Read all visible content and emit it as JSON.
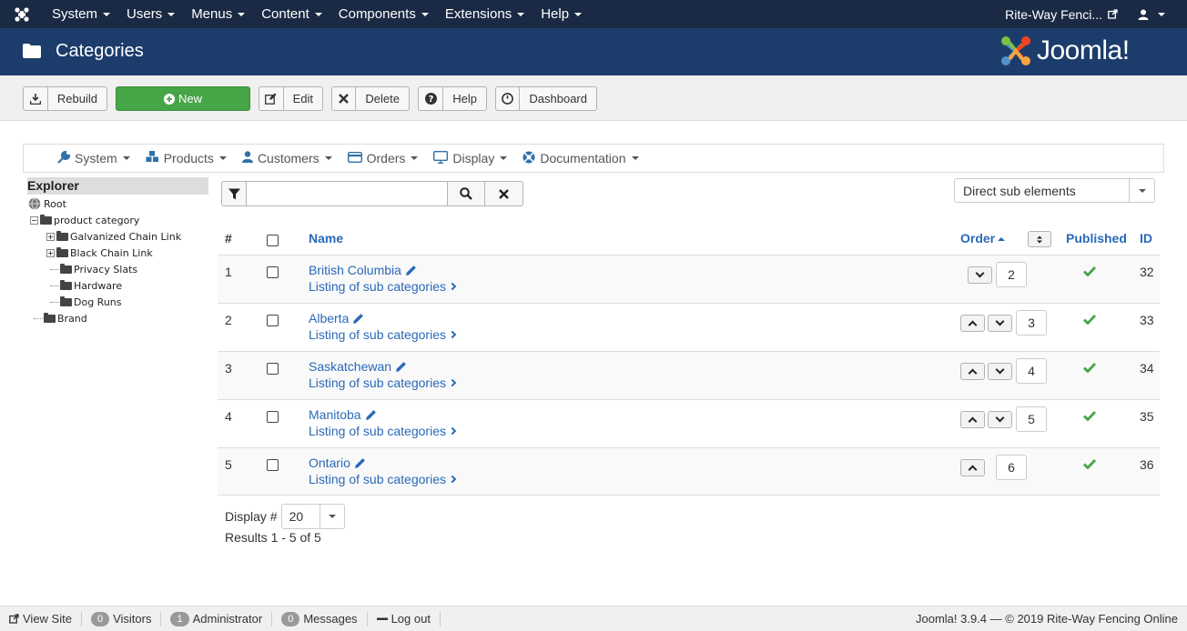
{
  "topnav": {
    "menus": [
      "System",
      "Users",
      "Menus",
      "Content",
      "Components",
      "Extensions",
      "Help"
    ],
    "site_name": "Rite-Way Fenci...",
    "icons": {
      "logo": "joomla-icon",
      "external": "external-link-icon",
      "user": "user-icon"
    }
  },
  "header": {
    "title": "Categories",
    "brand": "Joomla!"
  },
  "toolbar": {
    "rebuild": "Rebuild",
    "new": "New",
    "edit": "Edit",
    "delete": "Delete",
    "help": "Help",
    "dashboard": "Dashboard"
  },
  "subnav": {
    "items": [
      "System",
      "Products",
      "Customers",
      "Orders",
      "Display",
      "Documentation"
    ]
  },
  "explorer": {
    "title": "Explorer",
    "root": "Root",
    "product_category": "product category",
    "children": [
      "Galvanized Chain Link",
      "Black Chain Link",
      "Privacy Slats",
      "Hardware",
      "Dog Runs"
    ],
    "brand": "Brand"
  },
  "filters": {
    "search_placeholder": "",
    "direction": "Direct sub elements"
  },
  "table": {
    "headers": {
      "num": "#",
      "name": "Name",
      "order": "Order",
      "published": "Published",
      "id": "ID"
    },
    "sub_link": "Listing of sub categories",
    "rows": [
      {
        "num": "1",
        "name": "British Columbia",
        "order": "2",
        "id": "32",
        "up": false,
        "down": true
      },
      {
        "num": "2",
        "name": "Alberta",
        "order": "3",
        "id": "33",
        "up": true,
        "down": true
      },
      {
        "num": "3",
        "name": "Saskatchewan",
        "order": "4",
        "id": "34",
        "up": true,
        "down": true
      },
      {
        "num": "4",
        "name": "Manitoba",
        "order": "5",
        "id": "35",
        "up": true,
        "down": true
      },
      {
        "num": "5",
        "name": "Ontario",
        "order": "6",
        "id": "36",
        "up": true,
        "down": false
      }
    ]
  },
  "pager": {
    "display_label": "Display #",
    "display_value": "20",
    "results": "Results 1 - 5 of 5"
  },
  "footer": {
    "view_site": "View Site",
    "visitors_count": "0",
    "visitors": "Visitors",
    "admin_count": "1",
    "admin": "Administrator",
    "messages_count": "0",
    "messages": "Messages",
    "logout": "Log out",
    "copyright": "Joomla! 3.9.4 — © 2019 Rite-Way Fencing Online"
  },
  "colors": {
    "topnav": "#1a2a44",
    "header": "#1c3d6b",
    "link": "#2a69b8",
    "success": "#46a546"
  }
}
